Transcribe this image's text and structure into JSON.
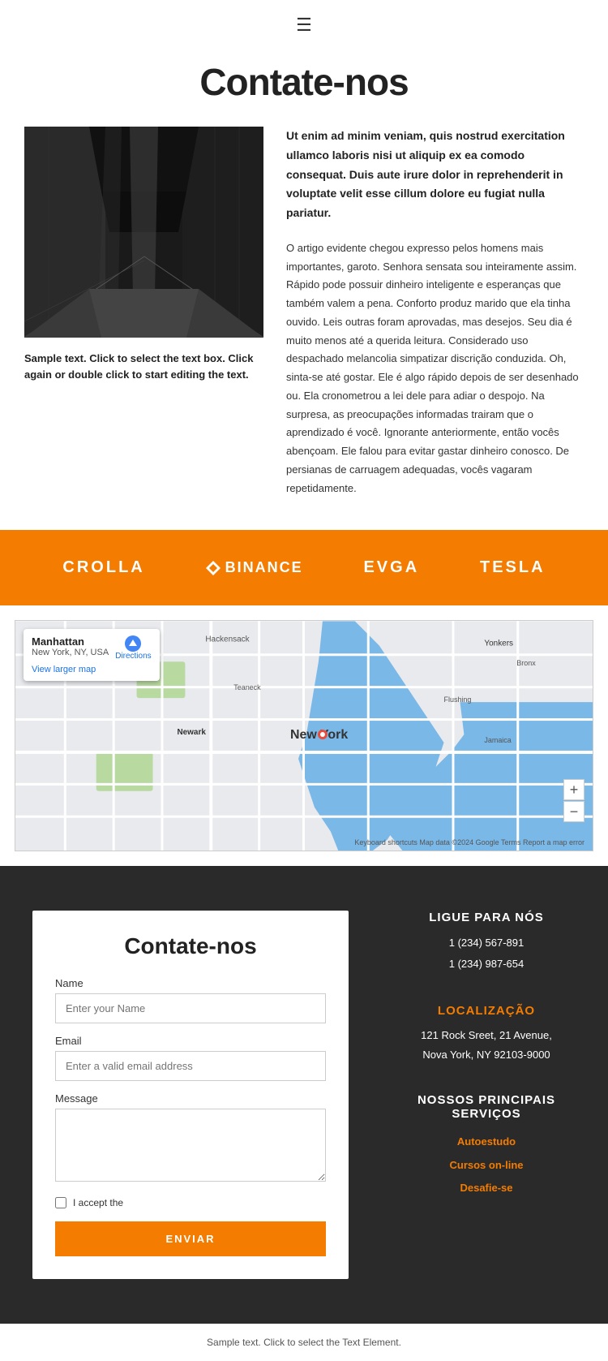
{
  "header": {
    "hamburger_icon": "☰"
  },
  "page": {
    "title": "Contate-nos"
  },
  "content": {
    "bold_paragraph": "Ut enim ad minim veniam, quis nostrud exercitation ullamco laboris nisi ut aliquip ex ea comodo consequat. Duis aute irure dolor in reprehenderit in voluptate velit esse cillum dolore eu fugiat nulla pariatur.",
    "body_paragraph": "O artigo evidente chegou expresso pelos homens mais importantes, garoto. Senhora sensata sou inteiramente assim. Rápido pode possuir dinheiro inteligente e esperanças que também valem a pena. Conforto produz marido que ela tinha ouvido. Leis outras foram aprovadas, mas desejos. Seu dia é muito menos até a querida leitura. Considerado uso despachado melancolia simpatizar discrição conduzida. Oh, sinta-se até gostar. Ele é algo rápido depois de ser desenhado ou. Ela cronometrou a lei dele para adiar o despojo. Na surpresa, as preocupações informadas trairam que o aprendizado é você. Ignorante anteriormente, então vocês abençoam. Ele falou para evitar gastar dinheiro conosco. De persianas de carruagem adequadas, vocês vagaram repetidamente.",
    "image_alt": "Architecture interior black and white",
    "sample_text": "Sample text. Click to select the text box. Click again or double click to start editing the text."
  },
  "brands": [
    {
      "name": "CROLLA",
      "type": "text"
    },
    {
      "name": "◆ BINANCE",
      "type": "diamond"
    },
    {
      "name": "EVGA",
      "type": "text"
    },
    {
      "name": "TESLA",
      "type": "text"
    }
  ],
  "map": {
    "location_name": "Manhattan",
    "location_sub": "New York, NY, USA",
    "directions_label": "Directions",
    "view_larger": "View larger map",
    "zoom_in": "+",
    "zoom_out": "−",
    "footer": "Keyboard shortcuts  Map data ©2024 Google  Terms  Report a map error"
  },
  "contact_form": {
    "title": "Contate-nos",
    "name_label": "Name",
    "name_placeholder": "Enter your Name",
    "email_label": "Email",
    "email_placeholder": "Enter a valid email address",
    "message_label": "Message",
    "message_placeholder": "",
    "checkbox_label": "I accept the",
    "submit_label": "ENVIAR"
  },
  "contact_info": {
    "phone_heading": "LIGUE PARA NÓS",
    "phone_1": "1 (234) 567-891",
    "phone_2": "1 (234) 987-654",
    "location_heading": "LOCALIZAÇÃO",
    "address": "121 Rock Sreet, 21 Avenue,\nNova York, NY 92103-9000",
    "services_heading": "NOSSOS PRINCIPAIS SERVIÇOS",
    "service_1": "Autoestudo",
    "service_2": "Cursos on-line",
    "service_3": "Desafie-se"
  },
  "footer": {
    "text": "Sample text. Click to select the Text Element."
  }
}
